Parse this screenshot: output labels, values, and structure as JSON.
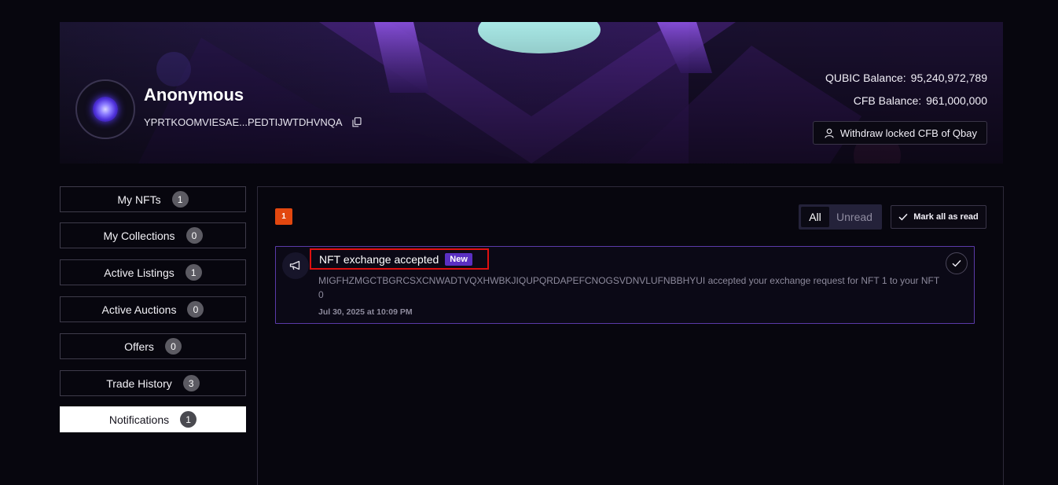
{
  "profile": {
    "name": "Anonymous",
    "address": "YPRTKOOMVIESAE...PEDTIJWTDHVNQA"
  },
  "balances": {
    "qubic_label": "QUBIC Balance:",
    "qubic_value": "95,240,972,789",
    "cfb_label": "CFB Balance:",
    "cfb_value": "961,000,000"
  },
  "withdraw_button": {
    "label": "Withdraw locked CFB of Qbay"
  },
  "sidebar": {
    "items": [
      {
        "label": "My NFTs",
        "count": "1"
      },
      {
        "label": "My Collections",
        "count": "0"
      },
      {
        "label": "Active Listings",
        "count": "1"
      },
      {
        "label": "Active Auctions",
        "count": "0"
      },
      {
        "label": "Offers",
        "count": "0"
      },
      {
        "label": "Trade History",
        "count": "3"
      },
      {
        "label": "Notifications",
        "count": "1"
      }
    ],
    "active_index": 6
  },
  "notifications": {
    "unread_count": "1",
    "filters": {
      "all": "All",
      "unread": "Unread"
    },
    "mark_all_label": "Mark all as read",
    "items": [
      {
        "title": "NFT exchange accepted",
        "tag": "New",
        "body": "MIGFHZMGCTBGRCSXCNWADTVQXHWBKJIQUPQRDAPEFCNOGSVDNVLUFNBBHYUI accepted your exchange request for NFT 1 to your NFT 0",
        "time": "Jul 30, 2025 at 10:09 PM"
      }
    ]
  },
  "colors": {
    "accent_purple": "#5a2fc2",
    "unread_orange": "#e2470f",
    "highlight_red": "#e01010"
  }
}
